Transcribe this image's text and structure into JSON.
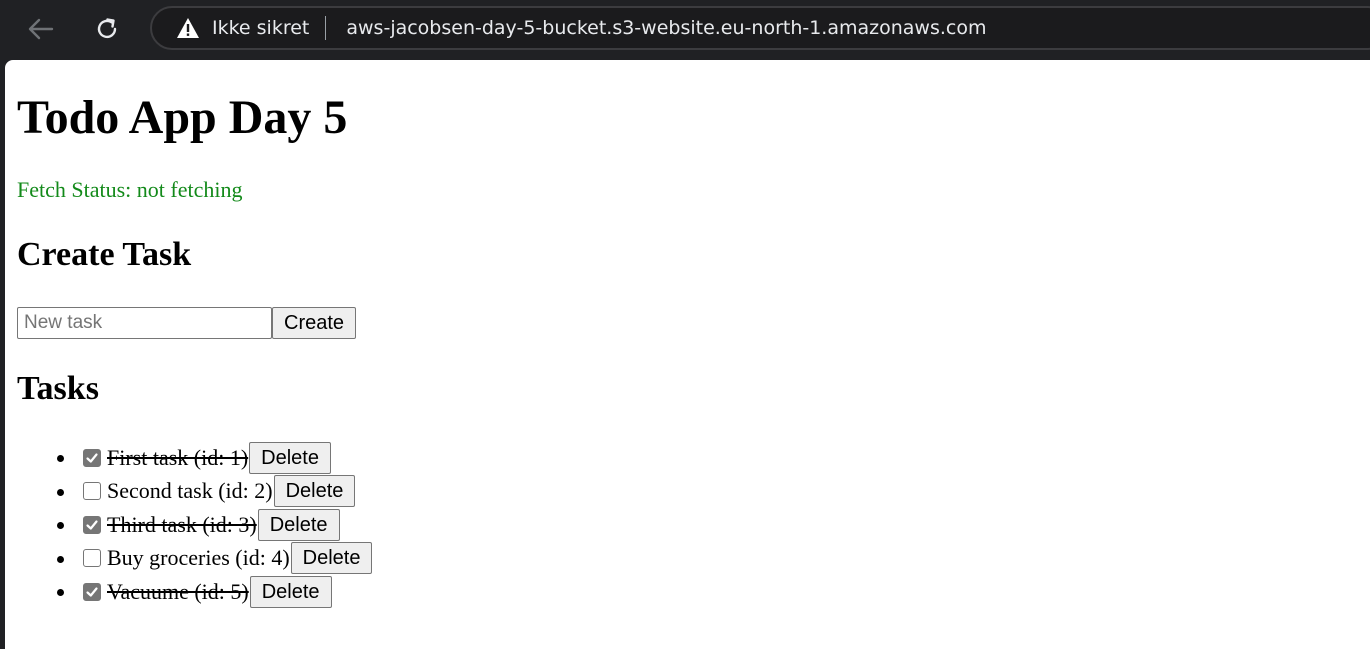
{
  "browser": {
    "security_label": "Ikke sikret",
    "url": "aws-jacobsen-day-5-bucket.s3-website.eu-north-1.amazonaws.com",
    "back_icon": "back-arrow-icon",
    "reload_icon": "reload-icon",
    "warning_icon": "warning-triangle-icon"
  },
  "page": {
    "title": "Todo App Day 5",
    "fetch_status": "Fetch Status: not fetching",
    "fetch_status_color": "#138a1a"
  },
  "create": {
    "heading": "Create Task",
    "input_placeholder": "New task",
    "input_value": "",
    "button_label": "Create"
  },
  "tasks": {
    "heading": "Tasks",
    "items": [
      {
        "text": "First task (id: 1)",
        "done": true,
        "delete_label": "Delete"
      },
      {
        "text": "Second task (id: 2)",
        "done": false,
        "delete_label": "Delete"
      },
      {
        "text": "Third task (id: 3)",
        "done": true,
        "delete_label": "Delete"
      },
      {
        "text": "Buy groceries (id: 4)",
        "done": false,
        "delete_label": "Delete"
      },
      {
        "text": "Vacuume (id: 5)",
        "done": true,
        "delete_label": "Delete"
      }
    ]
  }
}
